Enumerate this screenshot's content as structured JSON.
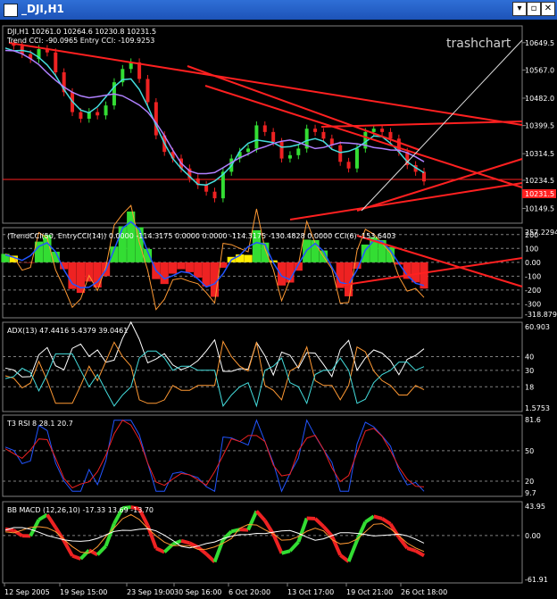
{
  "window": {
    "title": "_DJI,H1"
  },
  "watermark": "trashchart",
  "colors": {
    "bg": "#000000",
    "grid": "#808080",
    "trend": "#ff2020",
    "bull": "#33dd33",
    "bear": "#ee2222",
    "cyan": "#44dddd",
    "violet": "#b080ff",
    "orange": "#ff9933",
    "blue": "#2255ff",
    "yellow": "#ffee00",
    "white": "#ffffff"
  },
  "chart_data": [
    {
      "type": "line",
      "panel": "price",
      "title": "DJI,H1  10261.0 10264.6 10230.8 10231.5",
      "subtitle": "Trend CCI: -90.0965 Entry CCI: -109.9253",
      "ylim": [
        10105,
        10700
      ],
      "yticks": [
        "10649.5",
        "10567.0",
        "10482.0",
        "10399.5",
        "10314.5",
        "10234.5",
        "10149.5"
      ],
      "price_tag": "10231.5",
      "x": [
        0,
        6,
        12,
        18,
        24,
        30,
        36,
        42,
        48,
        54,
        60,
        66,
        72,
        78,
        84,
        90,
        96,
        102,
        108,
        114,
        120,
        126,
        132,
        138,
        144,
        150,
        156,
        162,
        168,
        174,
        180
      ],
      "series": [
        {
          "values": [
            10645,
            10640,
            10615,
            10600,
            10630,
            10620,
            10560,
            10500,
            10440,
            10420,
            10440,
            10430,
            10460,
            10530,
            10570,
            10590,
            10540,
            10470,
            10370,
            10320,
            10300,
            10270,
            10240,
            10220,
            10200,
            10180,
            10260,
            10300,
            10320,
            10330,
            10400,
            10380,
            10350,
            10300,
            10310,
            10330,
            10390,
            10380,
            10360,
            10340,
            10290,
            10270,
            10330,
            10380,
            10390,
            10380,
            10360,
            10320,
            10280,
            10260,
            10231
          ]
        }
      ]
    },
    {
      "type": "line",
      "panel": "cci",
      "title": "(TrendCCI(50, EntryCCI(14)) 0.0000 -114.3175 0.0000 0.0000 -114.3175 -130.4828 0.0000 CCI(6) -153.6403",
      "ylim": [
        -400,
        250
      ],
      "yticks": [
        "200",
        "100",
        "0.00",
        "-100",
        "-200",
        "-300"
      ],
      "top_label": "257.2294",
      "bottom_label": "-318.879"
    },
    {
      "type": "line",
      "panel": "adx",
      "title": "ADX(13) 47.4416 5.4379 39.0461",
      "ylim": [
        0,
        65
      ],
      "yticks": [
        "40",
        "30",
        "18"
      ],
      "top_label": "60.903",
      "bottom_label": "1.5753"
    },
    {
      "type": "line",
      "panel": "rsi",
      "title": "T3 RSI 8 28.1 20.7",
      "ylim": [
        5,
        85
      ],
      "yticks": [
        "50",
        "20"
      ],
      "top_label": "81.6",
      "bottom_label": "9.7"
    },
    {
      "type": "line",
      "panel": "macd",
      "title": "BB MACD (12,26,10) -17.33 13.69 -13.70",
      "ylim": [
        -70,
        50
      ],
      "yticks": [
        "0.00"
      ],
      "top_label": "43.95",
      "bottom_label": "-61.91"
    }
  ],
  "xaxis": {
    "labels": [
      "12 Sep 2005",
      "19 Sep 15:00",
      "23 Sep 19:00",
      "30 Sep 16:00",
      "6 Oct 20:00",
      "13 Oct 17:00",
      "19 Oct 21:00",
      "26 Oct 18:00"
    ]
  }
}
